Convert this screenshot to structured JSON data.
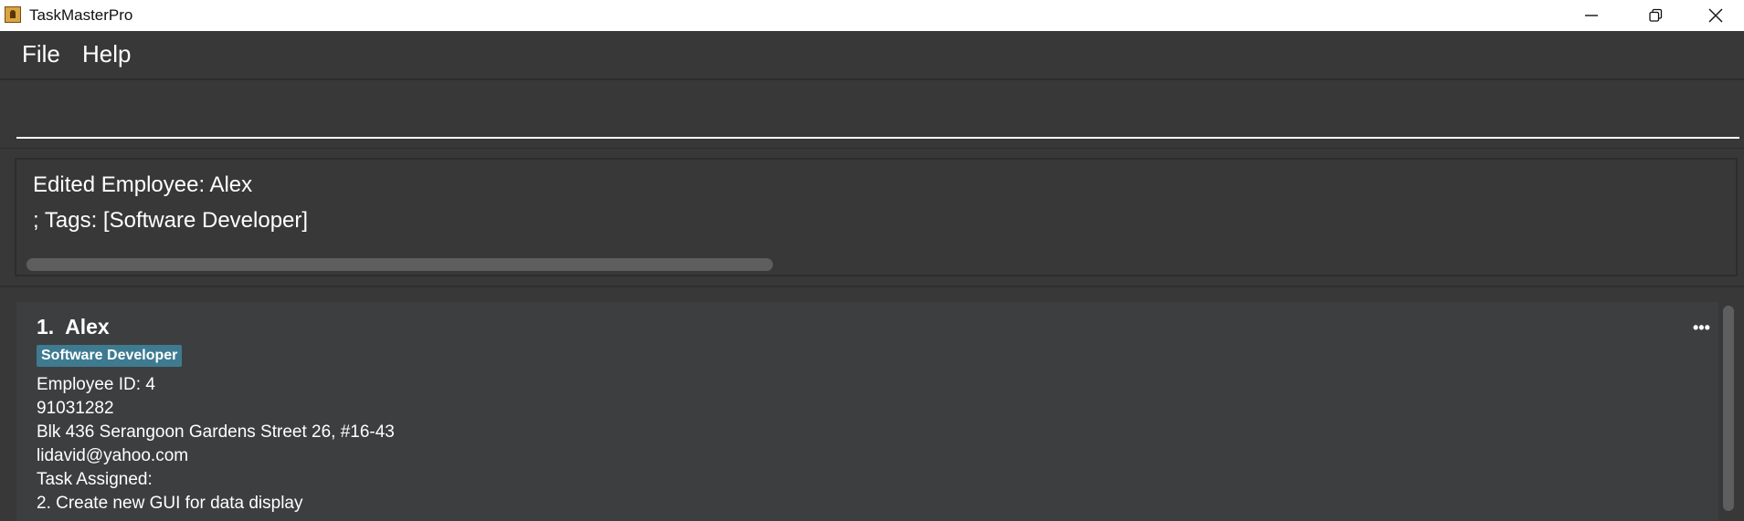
{
  "window": {
    "title": "TaskMasterPro",
    "controls": [
      "minimize-icon",
      "restore-icon",
      "close-icon"
    ]
  },
  "menu": {
    "items": [
      {
        "label": "File"
      },
      {
        "label": "Help"
      }
    ]
  },
  "command_box": {
    "value": "",
    "placeholder": ""
  },
  "result": {
    "line1": "Edited Employee: Alex",
    "line2": "; Tags: [Software Developer]"
  },
  "employees": [
    {
      "index": "1.",
      "name": "Alex",
      "tags": [
        "Software Developer"
      ],
      "employee_id": "Employee ID: 4",
      "phone": "91031282",
      "address": "Blk 436 Serangoon Gardens Street 26, #16-43",
      "email": "lidavid@yahoo.com",
      "task_header": "Task Assigned:",
      "task": "2. Create new GUI for data display",
      "more_icon": "ellipsis-icon"
    }
  ],
  "colors": {
    "background": "#383838",
    "card": "#3d3e40",
    "tag": "#3e7b91",
    "text": "#ffffff"
  }
}
